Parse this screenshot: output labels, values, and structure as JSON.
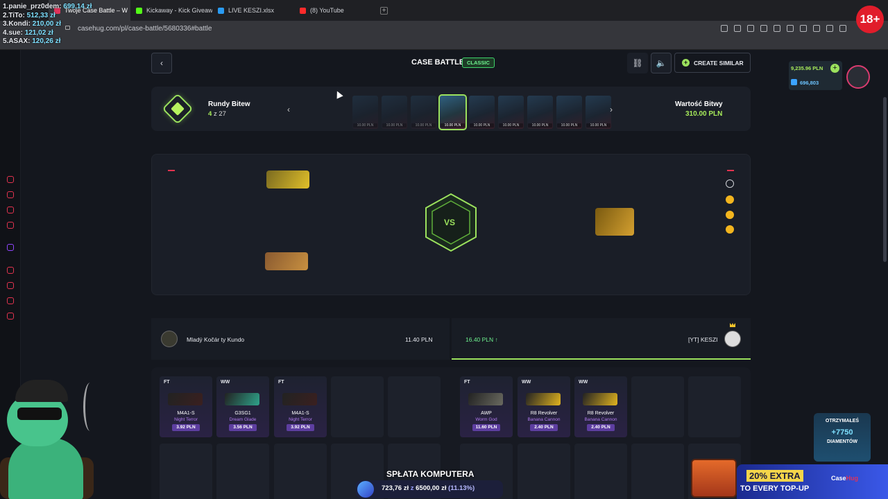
{
  "browser": {
    "tabs": [
      {
        "label": "Twoje Case Battle – W",
        "color": "#e0335a",
        "active": true
      },
      {
        "label": "Kickaway - Kick Giveaway",
        "color": "#53fc18",
        "active": false
      },
      {
        "label": "LIVE KESZI.xlsx",
        "color": "#2a9bf2",
        "active": false
      },
      {
        "label": "(8) YouTube",
        "color": "#ff2b2b",
        "active": false
      }
    ],
    "new_tab": "+",
    "url": "casehug.com/pl/case-battle/5680336#battle",
    "age_badge": "18+"
  },
  "leaderboard": [
    {
      "rank_name": "1.panie_prz0dem:",
      "amount": "699,14 zł"
    },
    {
      "rank_name": "2.TiTo:",
      "amount": "512,33 zł"
    },
    {
      "rank_name": "3.Kondi:",
      "amount": "210,00 zł"
    },
    {
      "rank_name": "4.sue:",
      "amount": "121,02 zł"
    },
    {
      "rank_name": "5.ASAX:",
      "amount": "120,26 zł"
    }
  ],
  "header": {
    "back": "‹",
    "title": "CASE BATTLE",
    "mode_badge": "CLASSIC",
    "link_icon": "link-icon",
    "sound_icon": "speaker-icon",
    "create_similar": "CREATE SIMILAR"
  },
  "wallet": {
    "balance": "9,235.96 PLN",
    "diamonds": "696,803",
    "add": "+"
  },
  "rounds": {
    "label": "Rundy Bitew",
    "current": "4",
    "separator": "z",
    "total": "27",
    "case_price": "10.00 PLN",
    "value_label": "Wartość Bitwy",
    "value": "310.00 PLN"
  },
  "arena": {
    "vs": "VS"
  },
  "players": {
    "left": {
      "name": "Mladý Kočár ty Kundo",
      "amount": "11.40 PLN"
    },
    "right": {
      "name": "[YT] KESZI",
      "amount": "16.40 PLN ↑"
    }
  },
  "items_left": [
    {
      "wear": "FT",
      "weapon": "M4A1-S",
      "skin": "Night Terror",
      "price": "3.92 PLN",
      "color": "#3a2020"
    },
    {
      "wear": "WW",
      "weapon": "G3SG1",
      "skin": "Dream Glade",
      "price": "3.56 PLN",
      "color": "#2fa38a"
    },
    {
      "wear": "FT",
      "weapon": "M4A1-S",
      "skin": "Night Terror",
      "price": "3.92 PLN",
      "color": "#3a2020"
    }
  ],
  "items_right": [
    {
      "wear": "FT",
      "weapon": "AWP",
      "skin": "Worm God",
      "price": "11.60 PLN",
      "color": "#6a6a60"
    },
    {
      "wear": "WW",
      "weapon": "R8 Revolver",
      "skin": "Banana Cannon",
      "price": "2.40 PLN",
      "color": "#e1b420"
    },
    {
      "wear": "WW",
      "weapon": "R8 Revolver",
      "skin": "Banana Cannon",
      "price": "2.40 PLN",
      "color": "#e1b420"
    }
  ],
  "overlay": {
    "donation_title": "SPŁATA KOMPUTERA",
    "donation_current": "723,76 zł",
    "donation_sep": "z",
    "donation_goal": "6500,00 zł",
    "donation_pct": "(11.13%)",
    "got_label": "OTRZYMAŁEŚ",
    "got_value": "+7750",
    "got_unit": "DIAMENTÓW",
    "promo_line1": "20% EXTRA",
    "promo_line2": "TO EVERY TOP-UP",
    "promo_brand_a": "Case",
    "promo_brand_b": "Hug"
  }
}
